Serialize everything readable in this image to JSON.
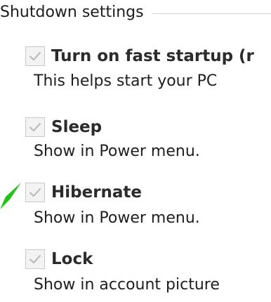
{
  "group": {
    "title": "Shutdown settings"
  },
  "options": [
    {
      "label": "Turn on fast startup (r",
      "description": "This helps start your PC",
      "checked": true,
      "disabled": true
    },
    {
      "label": "Sleep",
      "description": "Show in Power menu.",
      "checked": true,
      "disabled": true
    },
    {
      "label": "Hibernate",
      "description": "Show in Power menu.",
      "checked": true,
      "disabled": true
    },
    {
      "label": "Lock",
      "description": "Show in account picture",
      "checked": true,
      "disabled": true
    }
  ],
  "colors": {
    "accent_pointer": "#22c21a",
    "checkbox_border": "#c9c9c9",
    "checkmark": "#bdbdbd"
  },
  "annotation": {
    "icon": "green-arrow-pointer-icon"
  }
}
